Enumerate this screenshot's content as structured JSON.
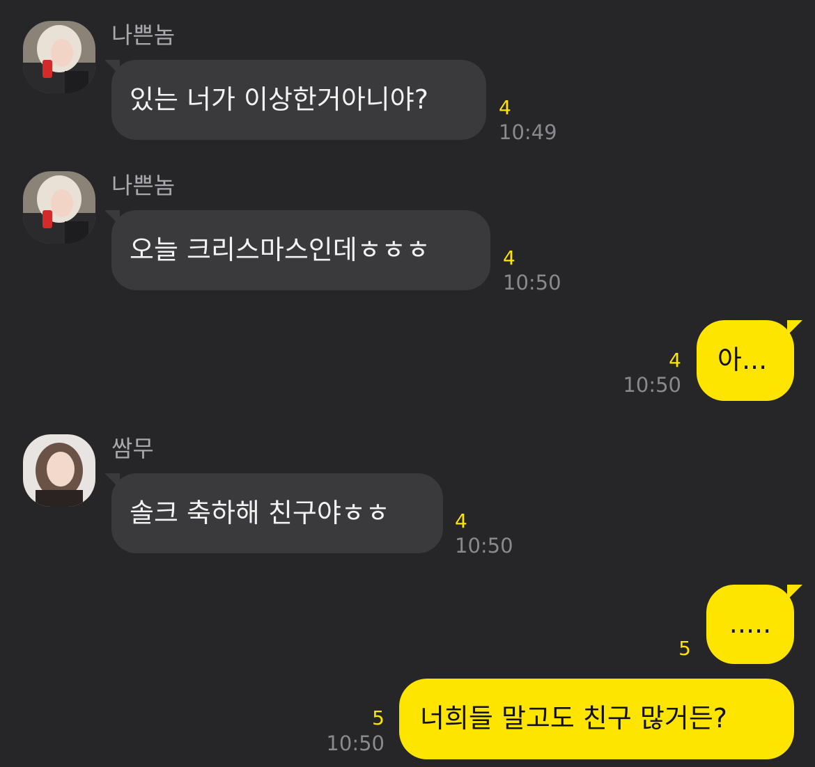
{
  "colors": {
    "background": "#262629",
    "incoming_bubble": "#3a3a3d",
    "outgoing_bubble": "#fee500",
    "unread_count": "#fee500",
    "timestamp": "#8a8a8e",
    "sender_name": "#a9a9ad"
  },
  "messages": [
    {
      "direction": "incoming",
      "sender": "나쁜놈",
      "avatar": "avatar-photo-icon",
      "text": "있는 너가 이상한거아니야?",
      "unread": "4",
      "time": "10:49"
    },
    {
      "direction": "incoming",
      "sender": "나쁜놈",
      "avatar": "avatar-photo-icon",
      "text": "오늘 크리스마스인데ㅎㅎㅎ",
      "unread": "4",
      "time": "10:50"
    },
    {
      "direction": "outgoing",
      "text": "아...",
      "unread": "4",
      "time": "10:50"
    },
    {
      "direction": "incoming",
      "sender": "쌈무",
      "avatar": "avatar-photo-icon",
      "text": "솔크 축하해 친구야ㅎㅎ",
      "unread": "4",
      "time": "10:50"
    },
    {
      "direction": "outgoing",
      "text": ".....",
      "unread": "5",
      "time": ""
    },
    {
      "direction": "outgoing",
      "text": "너희들 말고도 친구 많거든?",
      "unread": "5",
      "time": "10:50"
    }
  ]
}
